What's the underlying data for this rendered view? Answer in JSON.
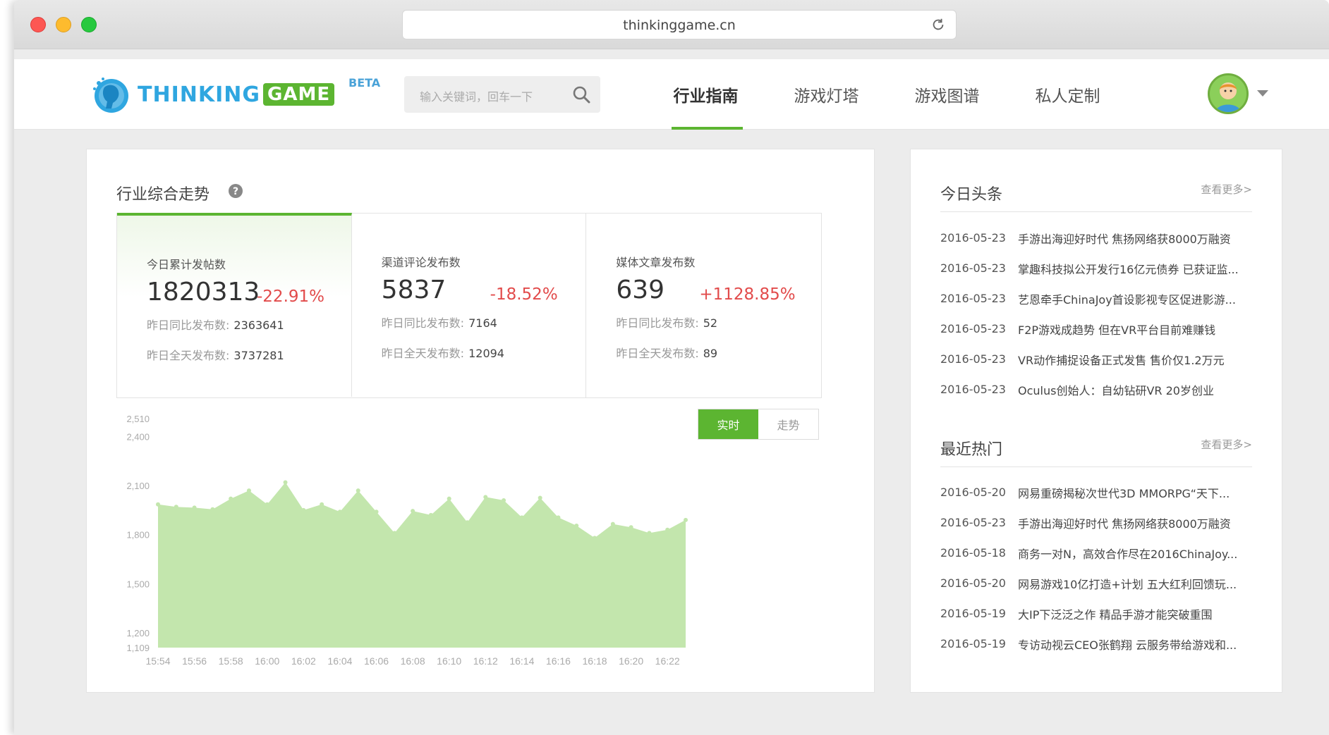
{
  "browser": {
    "url": "thinkinggame.cn"
  },
  "header": {
    "logo_main": "THINKING",
    "logo_accent": "GAME",
    "beta": "BETA",
    "search_placeholder": "输入关键词，回车一下",
    "nav": [
      {
        "label": "行业指南",
        "active": true
      },
      {
        "label": "游戏灯塔",
        "active": false
      },
      {
        "label": "游戏图谱",
        "active": false
      },
      {
        "label": "私人定制",
        "active": false
      }
    ]
  },
  "trend": {
    "title": "行业综合走势",
    "stats": [
      {
        "label": "今日累计发帖数",
        "value": "1820313",
        "change": "-22.91%",
        "sub1_label": "昨日同比发布数:",
        "sub1_value": "2363641",
        "sub2_label": "昨日全天发布数:",
        "sub2_value": "3737281"
      },
      {
        "label": "渠道评论发布数",
        "value": "5837",
        "change": "-18.52%",
        "sub1_label": "昨日同比发布数:",
        "sub1_value": "7164",
        "sub2_label": "昨日全天发布数:",
        "sub2_value": "12094"
      },
      {
        "label": "媒体文章发布数",
        "value": "639",
        "change": "+1128.85%",
        "sub1_label": "昨日同比发布数:",
        "sub1_value": "52",
        "sub2_label": "昨日全天发布数:",
        "sub2_value": "89"
      }
    ],
    "toggle": {
      "realtime": "实时",
      "trend": "走势"
    }
  },
  "chart_data": {
    "type": "area",
    "color": "#c3e6ad",
    "x": [
      "15:54",
      "15:55",
      "15:56",
      "15:57",
      "15:58",
      "15:59",
      "16:00",
      "16:01",
      "16:02",
      "16:03",
      "16:04",
      "16:05",
      "16:06",
      "16:07",
      "16:08",
      "16:09",
      "16:10",
      "16:11",
      "16:12",
      "16:13",
      "16:14",
      "16:15",
      "16:16",
      "16:17",
      "16:18",
      "16:19",
      "16:20",
      "16:21",
      "16:22",
      "16:23"
    ],
    "x_tick_labels": [
      "15:54",
      "15:56",
      "15:58",
      "16:00",
      "16:02",
      "16:04",
      "16:06",
      "16:08",
      "16:10",
      "16:12",
      "16:14",
      "16:16",
      "16:18",
      "16:20",
      "16:22"
    ],
    "y_tick_labels": [
      "2,510",
      "2,400",
      "2,100",
      "1,800",
      "1,500",
      "1,200",
      "1,109"
    ],
    "y_ticks": [
      2510,
      2400,
      2100,
      1800,
      1500,
      1200,
      1109
    ],
    "ylim": [
      1109,
      2510
    ],
    "values": [
      1985,
      1970,
      1965,
      1955,
      2020,
      2070,
      1985,
      2120,
      1950,
      1985,
      1940,
      2070,
      1940,
      1810,
      1945,
      1920,
      2020,
      1875,
      2030,
      2010,
      1905,
      2025,
      1905,
      1855,
      1780,
      1865,
      1845,
      1810,
      1830,
      1890
    ]
  },
  "headlines": {
    "title": "今日头条",
    "more": "查看更多>",
    "items": [
      {
        "date": "2016-05-23",
        "text": "手游出海迎好时代 焦扬网络获8000万融资"
      },
      {
        "date": "2016-05-23",
        "text": "掌趣科技拟公开发行16亿元债券 已获证监..."
      },
      {
        "date": "2016-05-23",
        "text": "艺恩牵手ChinaJoy首设影视专区促进影游..."
      },
      {
        "date": "2016-05-23",
        "text": "F2P游戏成趋势 但在VR平台目前难赚钱"
      },
      {
        "date": "2016-05-23",
        "text": "VR动作捕捉设备正式发售 售价仅1.2万元"
      },
      {
        "date": "2016-05-23",
        "text": "Oculus创始人：自幼钻研VR 20岁创业"
      }
    ]
  },
  "hot": {
    "title": "最近热门",
    "more": "查看更多>",
    "items": [
      {
        "date": "2016-05-20",
        "text": "网易重磅揭秘次世代3D MMORPG“天下..."
      },
      {
        "date": "2016-05-23",
        "text": "手游出海迎好时代 焦扬网络获8000万融资"
      },
      {
        "date": "2016-05-18",
        "text": "商务一对N，高效合作尽在2016ChinaJoy..."
      },
      {
        "date": "2016-05-20",
        "text": "网易游戏10亿打造+计划 五大红利回馈玩..."
      },
      {
        "date": "2016-05-19",
        "text": "大IP下泛泛之作 精品手游才能突破重围"
      },
      {
        "date": "2016-05-19",
        "text": "专访动视云CEO张鹤翔 云服务带给游戏和..."
      }
    ]
  }
}
